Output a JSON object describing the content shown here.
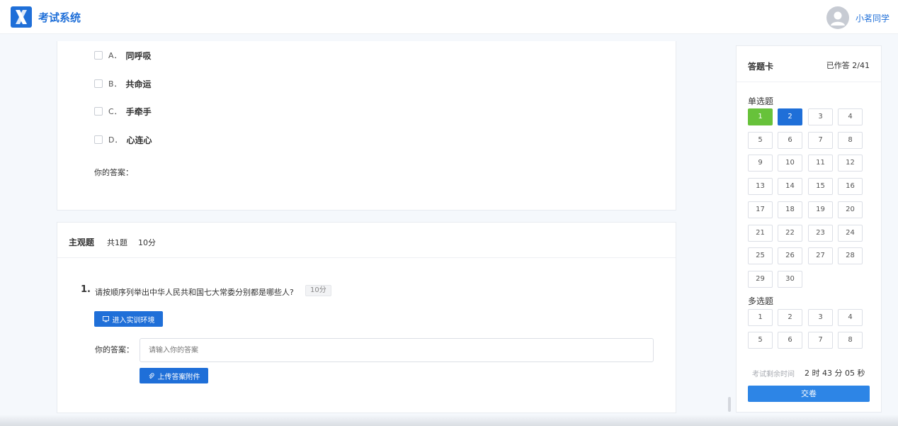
{
  "header": {
    "app_title": "考试系统",
    "user_name": "小茗同学"
  },
  "prev_question": {
    "options": [
      {
        "key": "A．",
        "text": "同呼吸"
      },
      {
        "key": "B．",
        "text": "共命运"
      },
      {
        "key": "C．",
        "text": "手牵手"
      },
      {
        "key": "D．",
        "text": "心连心"
      }
    ],
    "answer_label": "你的答案："
  },
  "subjective": {
    "section_title": "主观题",
    "count": "共1题",
    "score": "10分",
    "question": {
      "number": "1.",
      "text": "请按顺序列举出中华人民共和国七大常委分别都是哪些人?",
      "score_badge": "10分",
      "enter_button": "进入实训环境",
      "answer_label": "你的答案：",
      "answer_placeholder": "请输入你的答案",
      "upload_button": "上传答案附件"
    }
  },
  "answer_card": {
    "title": "答题卡",
    "progress": "已作答 2/41",
    "single_title": "单选题",
    "single_numbers": [
      "1",
      "2",
      "3",
      "4",
      "5",
      "6",
      "7",
      "8",
      "9",
      "10",
      "11",
      "12",
      "13",
      "14",
      "15",
      "16",
      "17",
      "18",
      "19",
      "20",
      "21",
      "22",
      "23",
      "24",
      "25",
      "26",
      "27",
      "28",
      "29",
      "30"
    ],
    "single_answered": [
      "1"
    ],
    "single_current": [
      "2"
    ],
    "multi_title": "多选题",
    "multi_numbers": [
      "1",
      "2",
      "3",
      "4",
      "5",
      "6",
      "7",
      "8"
    ],
    "timer_label": "考试剩余时间",
    "timer_value": "2 时 43 分 05 秒",
    "submit_label": "交卷"
  },
  "colors": {
    "primary": "#1f6fd8",
    "answered": "#67c23a",
    "submit": "#2d85e6"
  }
}
